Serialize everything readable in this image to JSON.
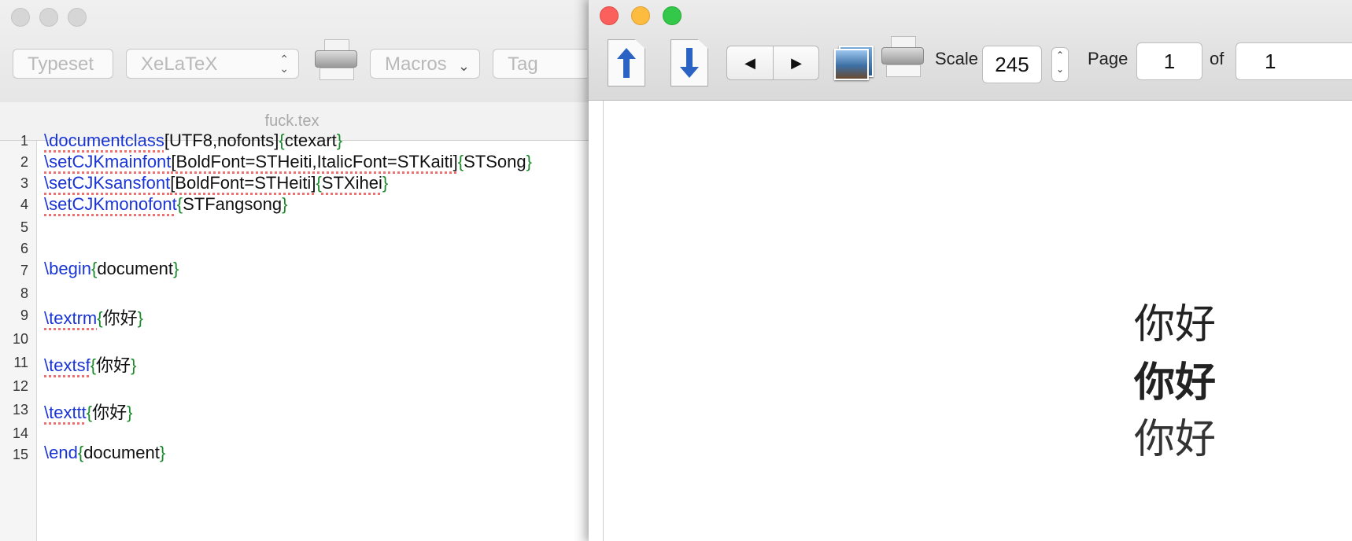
{
  "editor": {
    "toolbar": {
      "typeset_label": "Typeset",
      "engine_value": "XeLaTeX",
      "macros_label": "Macros",
      "tags_label": "Tag"
    },
    "filename": "fuck.tex",
    "line_numbers": [
      "1",
      "2",
      "3",
      "4",
      "5",
      "6",
      "7",
      "8",
      "9",
      "10",
      "11",
      "12",
      "13",
      "14",
      "15"
    ],
    "code": {
      "l1": {
        "cmd": "\\documentclass",
        "opt": "[UTF8,nofonts]",
        "ob": "{",
        "arg": "ctexart",
        "cb": "}"
      },
      "l2": {
        "cmd": "\\setCJKmainfont",
        "opt": "[BoldFont=STHeiti,ItalicFont=STKaiti]",
        "ob": "{",
        "arg": "STSong",
        "cb": "}"
      },
      "l3": {
        "cmd": "\\setCJKsansfont",
        "opt": "[BoldFont=STHeiti]",
        "ob": "{",
        "arg": "STXihei",
        "cb": "}"
      },
      "l4": {
        "cmd": "\\setCJKmonofont",
        "ob": "{",
        "arg": "STFangsong",
        "cb": "}"
      },
      "l7": {
        "cmd": "\\begin",
        "ob": "{",
        "arg": "document",
        "cb": "}"
      },
      "l9": {
        "cmd": "\\textrm",
        "ob": "{",
        "arg": "你好",
        "cb": "}"
      },
      "l11": {
        "cmd": "\\textsf",
        "ob": "{",
        "arg": "你好",
        "cb": "}"
      },
      "l13": {
        "cmd": "\\texttt",
        "ob": "{",
        "arg": "你好",
        "cb": "}"
      },
      "l15": {
        "cmd": "\\end",
        "ob": "{",
        "arg": "document",
        "cb": "}"
      }
    }
  },
  "preview": {
    "scale_label": "Scale",
    "scale_value": "245",
    "page_label": "Page",
    "page_value": "1",
    "of_label": "of",
    "total_pages": "1",
    "prev_glyph": "◀",
    "next_glyph": "▶",
    "output": [
      "你好",
      "你好",
      "你好"
    ]
  },
  "colors": {
    "command": "#1a35d6",
    "brace": "#1a8a2a",
    "traffic_red": "#fc605c",
    "traffic_yellow": "#fdbc40",
    "traffic_green": "#34c84a"
  }
}
